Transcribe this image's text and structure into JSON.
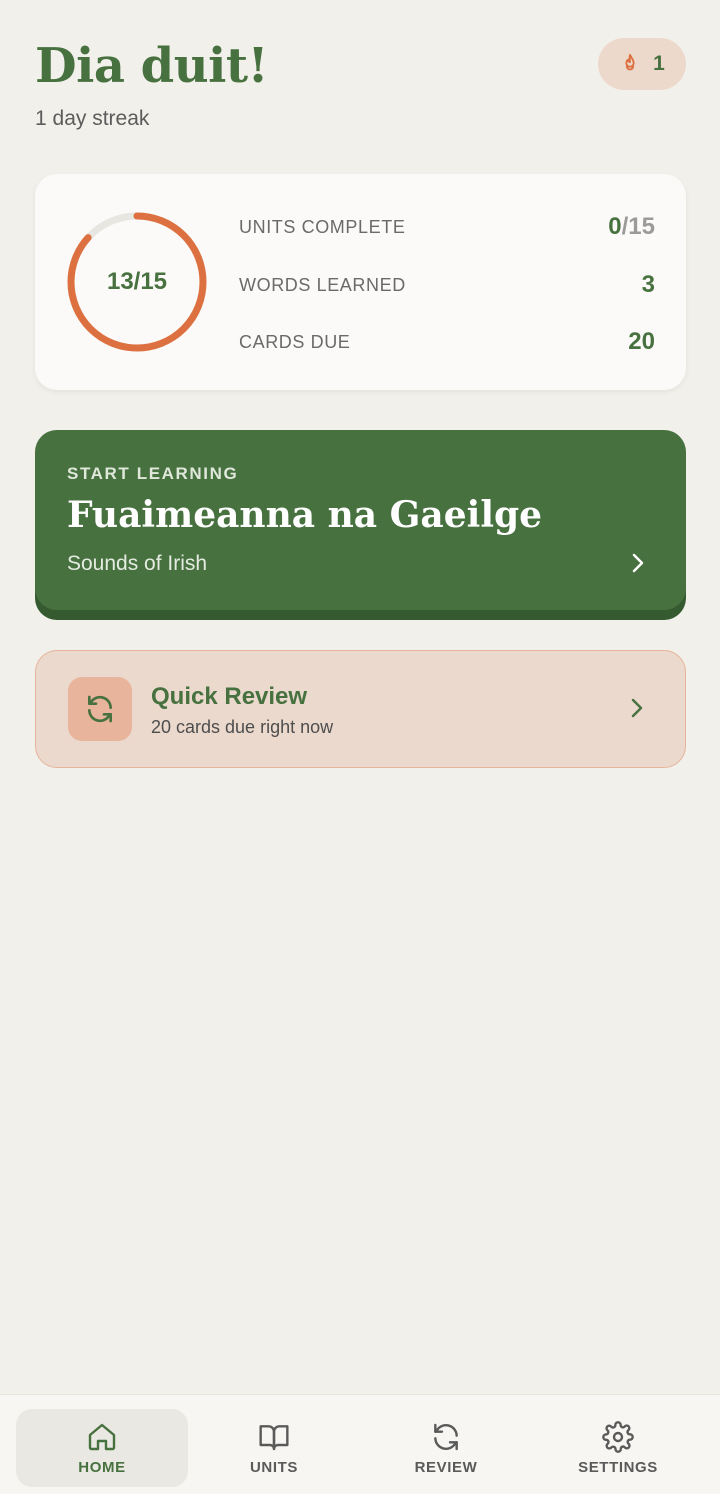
{
  "header": {
    "greeting": "Dia duit!",
    "streak_text": "1 day streak",
    "streak_count": "1"
  },
  "progress": {
    "ring_label": "13/15",
    "ring_fraction": 0.867,
    "stats": [
      {
        "label": "UNITS COMPLETE",
        "value": "0",
        "suffix": "/15"
      },
      {
        "label": "WORDS LEARNED",
        "value": "3",
        "suffix": ""
      },
      {
        "label": "CARDS DUE",
        "value": "20",
        "suffix": ""
      }
    ]
  },
  "learn": {
    "eyebrow": "START LEARNING",
    "title": "Fuaimeanna na Gaeilge",
    "subtitle": "Sounds of Irish"
  },
  "quick_review": {
    "title": "Quick Review",
    "subtitle": "20 cards due right now"
  },
  "nav": {
    "items": [
      {
        "label": "HOME",
        "icon": "home-icon",
        "active": true
      },
      {
        "label": "UNITS",
        "icon": "book-icon",
        "active": false
      },
      {
        "label": "REVIEW",
        "icon": "refresh-icon",
        "active": false
      },
      {
        "label": "SETTINGS",
        "icon": "gear-icon",
        "active": false
      }
    ]
  },
  "colors": {
    "brand_green": "#487140",
    "accent_orange": "#dd7040",
    "background": "#f2f0eb"
  }
}
